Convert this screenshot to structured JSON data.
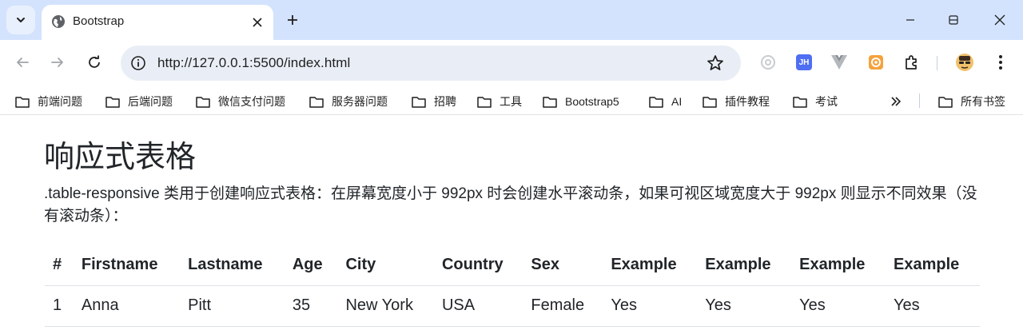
{
  "browser": {
    "tab_title": "Bootstrap",
    "url": "http://127.0.0.1:5500/index.html",
    "ext_badge": "JH"
  },
  "bookmarks": [
    {
      "label": "前端问题"
    },
    {
      "label": "后端问题"
    },
    {
      "label": "微信支付问题"
    },
    {
      "label": "服务器问题"
    },
    {
      "label": "招聘"
    },
    {
      "label": "工具"
    },
    {
      "label": "Bootstrap5"
    },
    {
      "label": "AI"
    },
    {
      "label": "插件教程"
    },
    {
      "label": "考试"
    }
  ],
  "all_bookmarks": "所有书签",
  "page": {
    "title": "响应式表格",
    "description": ".table-responsive 类用于创建响应式表格：在屏幕宽度小于 992px 时会创建水平滚动条，如果可视区域宽度大于 992px 则显示不同效果（没有滚动条）：",
    "table": {
      "headers": [
        "#",
        "Firstname",
        "Lastname",
        "Age",
        "City",
        "Country",
        "Sex",
        "Example",
        "Example",
        "Example",
        "Example"
      ],
      "rows": [
        [
          "1",
          "Anna",
          "Pitt",
          "35",
          "New York",
          "USA",
          "Female",
          "Yes",
          "Yes",
          "Yes",
          "Yes"
        ]
      ]
    }
  },
  "colors": {
    "tabstrip_bg": "#d3e3fd",
    "omnibox_bg": "#e9eef6",
    "text": "#212529"
  }
}
